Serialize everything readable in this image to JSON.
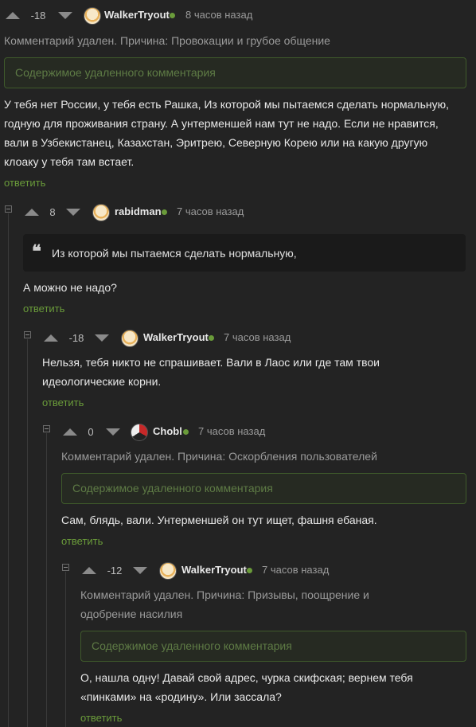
{
  "comments": [
    {
      "score": "-18",
      "username": "WalkerTryout",
      "time": "8 часов назад",
      "deleted_notice": "Комментарий удален. Причина: Провокации и грубое общение",
      "deleted_box": "Содержимое удаленного комментария",
      "text_lines": [
        "У тебя нет России, у тебя есть Рашка, Из которой мы пытаемся сделать нормальную,",
        "годную для проживания страну. А унтерменшей нам тут не надо. Если не нравится,",
        "вали в Узбекистанец, Казахстан, Эритрею, Северную Корею или на какую другую",
        "клоаку у тебя там встает."
      ],
      "reply": "ответить"
    },
    {
      "score": "8",
      "username": "rabidman",
      "time": "7 часов назад",
      "quote": "Из которой мы пытаемся сделать нормальную,",
      "text_lines": [
        "А можно не надо?"
      ],
      "reply": "ответить"
    },
    {
      "score": "-18",
      "username": "WalkerTryout",
      "time": "7 часов назад",
      "text_lines": [
        "Нельзя, тебя никто не спрашивает. Вали в Лаос или где там твои",
        "идеологические корни."
      ],
      "reply": "ответить"
    },
    {
      "score": "0",
      "username": "Chobl",
      "time": "7 часов назад",
      "deleted_notice": "Комментарий удален. Причина: Оскорбления пользователей",
      "deleted_box": "Содержимое удаленного комментария",
      "text_lines": [
        "Сам, блядь, вали. Унтерменшей он тут ищет, фашня ебаная."
      ],
      "reply": "ответить"
    },
    {
      "score": "-12",
      "username": "WalkerTryout",
      "time": "7 часов назад",
      "deleted_notice_lines": [
        "Комментарий удален. Причина: Призывы, поощрение и",
        "одобрение насилия"
      ],
      "deleted_box": "Содержимое удаленного комментария",
      "text_lines": [
        "О, нашла одну! Давай свой адрес, чурка скифская; вернем тебя",
        "«пинками» на «родину». Или зассала?"
      ],
      "reply": "ответить"
    }
  ],
  "colors": {
    "background": "#232323",
    "online_dot": "#6a9b3a",
    "reply_link": "#6a9b3a",
    "deleted_border": "#3f5a2b"
  }
}
